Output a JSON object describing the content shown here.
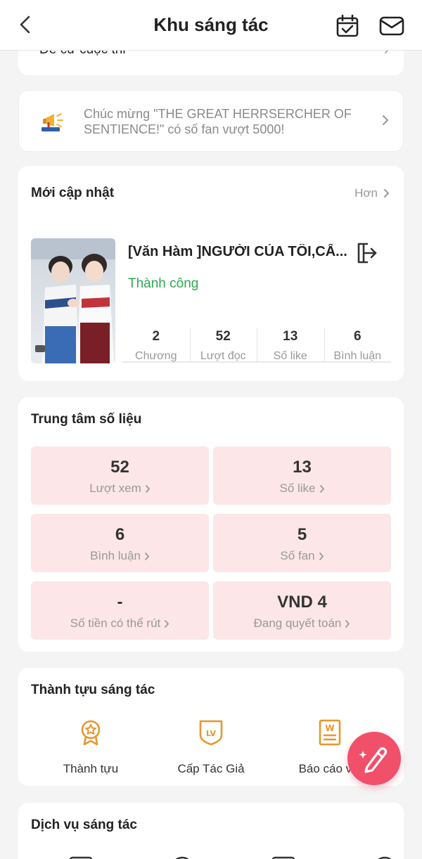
{
  "header": {
    "title": "Khu sáng tác"
  },
  "top_card": {
    "label": "Đề cử cuộc thi"
  },
  "notice": {
    "text": "Chúc mừng \"THE GREAT HERRSERCHER OF SENTIENCE!\" có số fan vượt 5000!"
  },
  "updates": {
    "title": "Mới cập nhật",
    "more": "Hơn",
    "book": {
      "title": "[Văn Hàm ]NGƯỜI CỦA TÔI,CẤ...",
      "status": "Thành công",
      "stats": [
        {
          "num": "2",
          "label": "Chương"
        },
        {
          "num": "52",
          "label": "Lượt đọc"
        },
        {
          "num": "13",
          "label": "Số like"
        },
        {
          "num": "6",
          "label": "Bình luận"
        }
      ]
    }
  },
  "data_center": {
    "title": "Trung tâm số liệu",
    "tiles": [
      {
        "value": "52",
        "label": "Lượt xem"
      },
      {
        "value": "13",
        "label": "Số like"
      },
      {
        "value": "6",
        "label": "Bình luận"
      },
      {
        "value": "5",
        "label": "Số fan"
      },
      {
        "value": "-",
        "label": "Số tiền có thể rút"
      },
      {
        "value": "VND 4",
        "label": "Đang quyết toán"
      }
    ]
  },
  "achievements": {
    "title": "Thành tựu sáng tác",
    "items": [
      {
        "label": "Thành tựu",
        "icon": "medal-icon"
      },
      {
        "label": "Cấp Tác Giả",
        "icon": "level-badge-icon"
      },
      {
        "label": "Báo cáo vin",
        "icon": "report-icon"
      }
    ]
  },
  "services": {
    "title": "Dịch vụ sáng tác"
  },
  "colors": {
    "accent": "#f0506a",
    "success": "#2ea84f",
    "tile_bg": "#fde6e7",
    "icon_orange": "#e8962e"
  }
}
